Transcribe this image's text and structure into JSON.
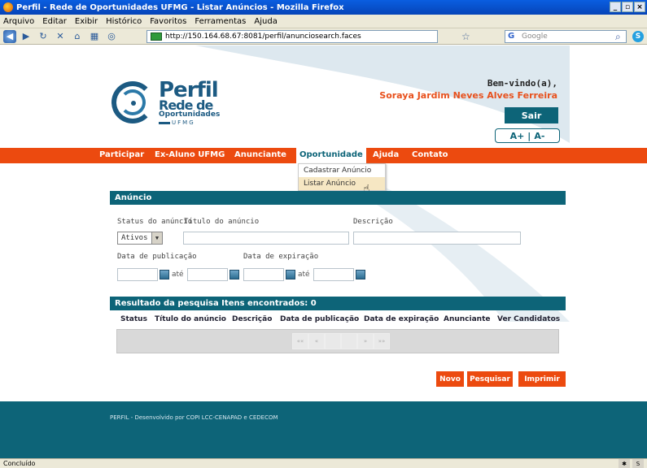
{
  "window": {
    "title": "Perfil - Rede de Oportunidades UFMG - Listar Anúncios - Mozilla Firefox"
  },
  "menubar": {
    "items": [
      "Arquivo",
      "Editar",
      "Exibir",
      "Histórico",
      "Favoritos",
      "Ferramentas",
      "Ajuda"
    ]
  },
  "browser": {
    "url": "http://150.164.68.67:8081/perfil/anunciosearch.faces",
    "search_placeholder": "Google",
    "status": "Concluído"
  },
  "logo": {
    "line1": "Perfil",
    "line2": "Rede de",
    "line3": "Oportunidades",
    "line4": "UFMG"
  },
  "user": {
    "greeting": "Bem-vindo(a),",
    "name": "Soraya Jardim Neves Alves Ferreira",
    "logout": "Sair",
    "font_increase": "A+",
    "font_separator": "|",
    "font_decrease": "A-"
  },
  "nav": {
    "items": [
      "Participar",
      "Ex-Aluno UFMG",
      "Anunciante",
      "Oportunidade",
      "Ajuda",
      "Contato"
    ],
    "active": "Oportunidade"
  },
  "dropdown": {
    "items": [
      "Cadastrar Anúncio",
      "Listar Anúncio"
    ],
    "highlighted": "Listar Anúncio"
  },
  "search": {
    "title": "Anúncio",
    "status_label": "Status do anúncio",
    "title_label": "Título do anúncio",
    "description_label": "Descrição",
    "status_value": "Ativos",
    "pub_date_label": "Data de publicação",
    "exp_date_label": "Data de expiração",
    "ate": "até"
  },
  "results": {
    "title": "Resultado da pesquisa Itens encontrados: 0",
    "columns": [
      "Status",
      "Título do anúncio",
      "Descrição",
      "Data de publicação",
      "Data de expiração",
      "Anunciante",
      "Ver Candidatos"
    ],
    "pager": [
      "««",
      "«",
      "",
      "",
      "»",
      "»»"
    ]
  },
  "actions": {
    "new": "Novo",
    "search": "Pesquisar",
    "print": "Imprimir"
  },
  "footer": {
    "text": "PERFIL - Desenvolvido por COPI LCC-CENAPAD e CEDECOM"
  },
  "colors": {
    "accent": "#ec4a0f",
    "primary": "#0d6478"
  }
}
